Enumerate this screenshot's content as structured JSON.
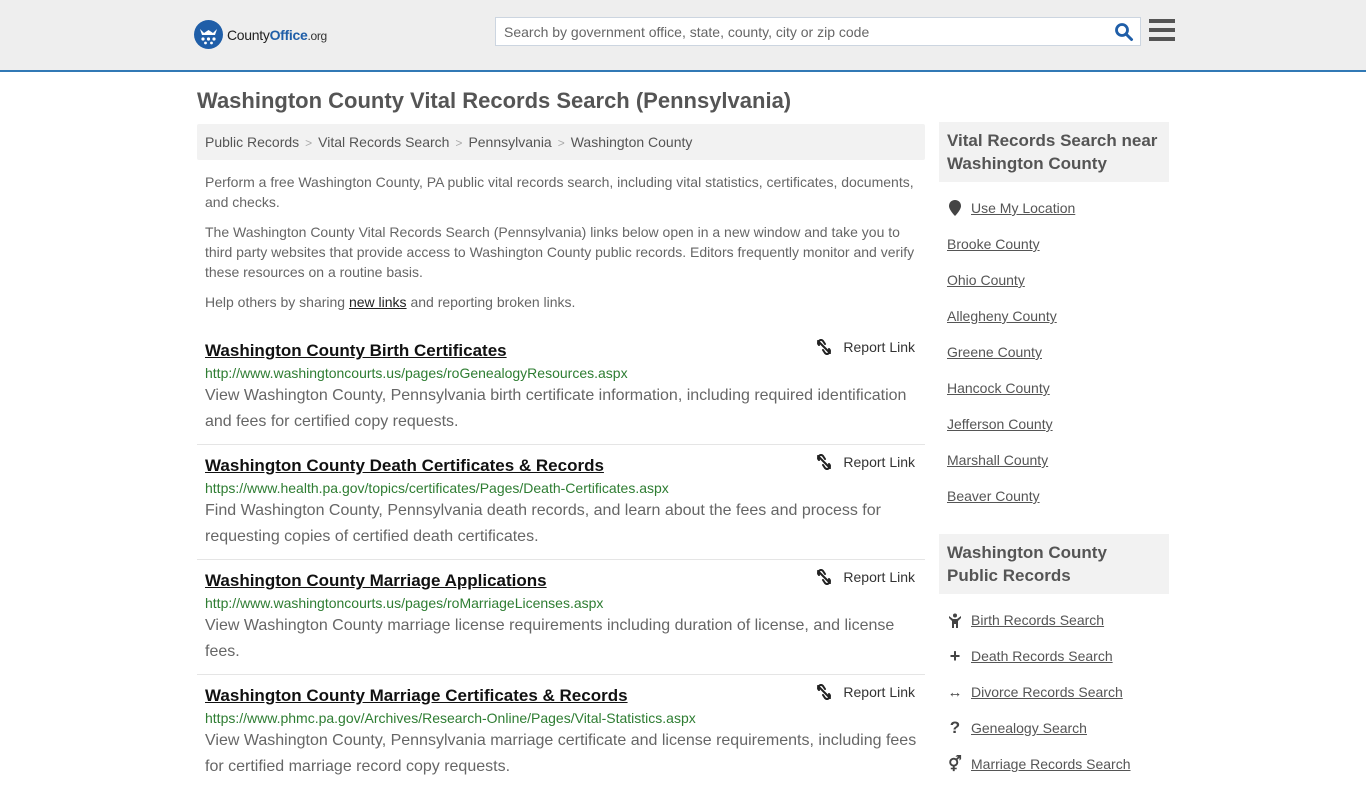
{
  "header": {
    "logo": {
      "county": "County",
      "office": "Office",
      "org": ".org"
    },
    "search_placeholder": "Search by government office, state, county, city or zip code",
    "search_value": ""
  },
  "page": {
    "title": "Washington County Vital Records Search (Pennsylvania)"
  },
  "breadcrumb": [
    "Public Records",
    "Vital Records Search",
    "Pennsylvania",
    "Washington County"
  ],
  "intro": {
    "p1": "Perform a free Washington County, PA public vital records search, including vital statistics, certificates, documents, and checks.",
    "p2": "The Washington County Vital Records Search (Pennsylvania) links below open in a new window and take you to third party websites that provide access to Washington County public records. Editors frequently monitor and verify these resources on a routine basis.",
    "p3_before": "Help others by sharing ",
    "p3_link": "new links",
    "p3_after": " and reporting broken links."
  },
  "report_label": "Report Link",
  "results": [
    {
      "title": "Washington County Birth Certificates",
      "url": "http://www.washingtoncourts.us/pages/roGenealogyResources.aspx",
      "description": "View Washington County, Pennsylvania birth certificate information, including required identification and fees for certified copy requests."
    },
    {
      "title": "Washington County Death Certificates & Records",
      "url": "https://www.health.pa.gov/topics/certificates/Pages/Death-Certificates.aspx",
      "description": "Find Washington County, Pennsylvania death records, and learn about the fees and process for requesting copies of certified death certificates."
    },
    {
      "title": "Washington County Marriage Applications",
      "url": "http://www.washingtoncourts.us/pages/roMarriageLicenses.aspx",
      "description": "View Washington County marriage license requirements including duration of license, and license fees."
    },
    {
      "title": "Washington County Marriage Certificates & Records",
      "url": "https://www.phmc.pa.gov/Archives/Research-Online/Pages/Vital-Statistics.aspx",
      "description": "View Washington County, Pennsylvania marriage certificate and license requirements, including fees for certified marriage record copy requests."
    }
  ],
  "sidebar": {
    "nearby_heading": "Vital Records Search near Washington County",
    "use_location": "Use My Location",
    "nearby": [
      "Brooke County",
      "Ohio County",
      "Allegheny County",
      "Greene County",
      "Hancock County",
      "Jefferson County",
      "Marshall County",
      "Beaver County"
    ],
    "public_heading": "Washington County Public Records",
    "public_links": [
      {
        "label": "Birth Records Search",
        "icon": "child-icon",
        "glyph": "†"
      },
      {
        "label": "Death Records Search",
        "icon": "plus-icon",
        "glyph": "+"
      },
      {
        "label": "Divorce Records Search",
        "icon": "arrows-h-icon",
        "glyph": "↔"
      },
      {
        "label": "Genealogy Search",
        "icon": "question-icon",
        "glyph": "?"
      },
      {
        "label": "Marriage Records Search",
        "icon": "venus-mars-icon",
        "glyph": "⚥"
      }
    ]
  },
  "colors": {
    "brand_blue": "#1f5ea8",
    "header_border": "#3179b5",
    "url_green": "#2e7d32"
  }
}
